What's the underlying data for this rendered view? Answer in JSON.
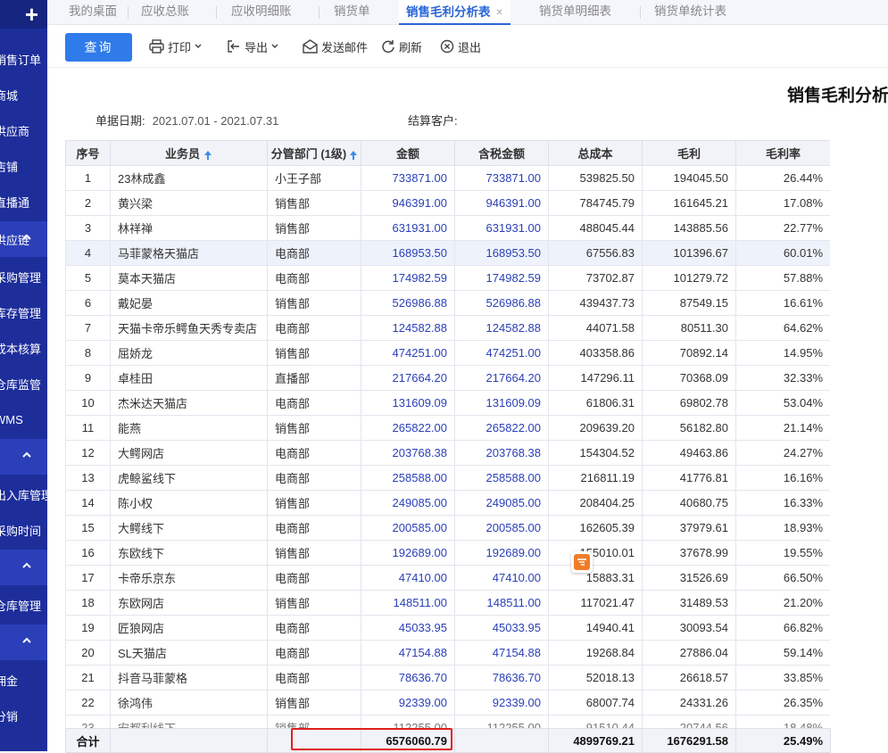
{
  "sidebar": {
    "plus_label": "+",
    "items": [
      {
        "label": "销售订单"
      },
      {
        "label": "商城"
      },
      {
        "label": "供应商"
      },
      {
        "label": "店铺"
      },
      {
        "label": "直播通"
      }
    ],
    "groups": [
      "供应链",
      "",
      "",
      ""
    ],
    "sub_items": [
      "采购管理",
      "库存管理",
      "成本核算",
      "仓库监管",
      "WMS",
      "出入库管理",
      "采购时间",
      "仓库管理",
      "佣金",
      "分销"
    ]
  },
  "tabs": [
    {
      "label": "我的桌面",
      "active": false
    },
    {
      "label": "应收总账",
      "active": false
    },
    {
      "label": "应收明细账",
      "active": false
    },
    {
      "label": "销货单",
      "active": false
    },
    {
      "label": "销售毛利分析表",
      "active": true,
      "close": "×"
    },
    {
      "label": "销货单明细表",
      "active": false
    },
    {
      "label": "销货单统计表",
      "active": false
    }
  ],
  "toolbar": {
    "query": "查询",
    "print": "打印",
    "export": "导出",
    "email": "发送邮件",
    "refresh": "刷新",
    "exit": "退出"
  },
  "report": {
    "title": "销售毛利分析表",
    "date_label": "单据日期:",
    "date_value": "2021.07.01 - 2021.07.31",
    "customer_label": "结算客户:",
    "customer_value": ""
  },
  "table": {
    "columns": [
      "序号",
      "业务员",
      "分管部门 (1级)",
      "金额",
      "含税金额",
      "总成本",
      "毛利",
      "毛利率"
    ],
    "rows": [
      [
        "1",
        "23林成鑫",
        "小王子部",
        "733871.00",
        "733871.00",
        "539825.50",
        "194045.50",
        "26.44%"
      ],
      [
        "2",
        "黄兴梁",
        "销售部",
        "946391.00",
        "946391.00",
        "784745.79",
        "161645.21",
        "17.08%"
      ],
      [
        "3",
        "林祥禅",
        "销售部",
        "631931.00",
        "631931.00",
        "488045.44",
        "143885.56",
        "22.77%"
      ],
      [
        "4",
        "马菲蒙格天猫店",
        "电商部",
        "168953.50",
        "168953.50",
        "67556.83",
        "101396.67",
        "60.01%"
      ],
      [
        "5",
        "莫本天猫店",
        "电商部",
        "174982.59",
        "174982.59",
        "73702.87",
        "101279.72",
        "57.88%"
      ],
      [
        "6",
        "戴妃晏",
        "销售部",
        "526986.88",
        "526986.88",
        "439437.73",
        "87549.15",
        "16.61%"
      ],
      [
        "7",
        "天猫卡帝乐鳄鱼天秀专卖店",
        "电商部",
        "124582.88",
        "124582.88",
        "44071.58",
        "80511.30",
        "64.62%"
      ],
      [
        "8",
        "屈娇龙",
        "销售部",
        "474251.00",
        "474251.00",
        "403358.86",
        "70892.14",
        "14.95%"
      ],
      [
        "9",
        "卓桂田",
        "直播部",
        "217664.20",
        "217664.20",
        "147296.11",
        "70368.09",
        "32.33%"
      ],
      [
        "10",
        "杰米达天猫店",
        "电商部",
        "131609.09",
        "131609.09",
        "61806.31",
        "69802.78",
        "53.04%"
      ],
      [
        "11",
        "能燕",
        "销售部",
        "265822.00",
        "265822.00",
        "209639.20",
        "56182.80",
        "21.14%"
      ],
      [
        "12",
        "大鳄网店",
        "电商部",
        "203768.38",
        "203768.38",
        "154304.52",
        "49463.86",
        "24.27%"
      ],
      [
        "13",
        "虎鲸鲨线下",
        "电商部",
        "258588.00",
        "258588.00",
        "216811.19",
        "41776.81",
        "16.16%"
      ],
      [
        "14",
        "陈小权",
        "销售部",
        "249085.00",
        "249085.00",
        "208404.25",
        "40680.75",
        "16.33%"
      ],
      [
        "15",
        "大鳄线下",
        "电商部",
        "200585.00",
        "200585.00",
        "162605.39",
        "37979.61",
        "18.93%"
      ],
      [
        "16",
        "东欧线下",
        "销售部",
        "192689.00",
        "192689.00",
        "155010.01",
        "37678.99",
        "19.55%"
      ],
      [
        "17",
        "卡帝乐京东",
        "电商部",
        "47410.00",
        "47410.00",
        "15883.31",
        "31526.69",
        "66.50%"
      ],
      [
        "18",
        "东欧网店",
        "销售部",
        "148511.00",
        "148511.00",
        "117021.47",
        "31489.53",
        "21.20%"
      ],
      [
        "19",
        "匠狼网店",
        "电商部",
        "45033.95",
        "45033.95",
        "14940.41",
        "30093.54",
        "66.82%"
      ],
      [
        "20",
        "SL天猫店",
        "电商部",
        "47154.88",
        "47154.88",
        "19268.84",
        "27886.04",
        "59.14%"
      ],
      [
        "21",
        "抖音马菲蒙格",
        "电商部",
        "78636.70",
        "78636.70",
        "52018.13",
        "26618.57",
        "33.85%"
      ],
      [
        "22",
        "徐鸿伟",
        "销售部",
        "92339.00",
        "92339.00",
        "68007.74",
        "24331.26",
        "26.35%"
      ],
      [
        "23",
        "安都利线下",
        "销售部",
        "112255.00",
        "112255.00",
        "91510.44",
        "20744.56",
        "18.48%"
      ]
    ],
    "totals": {
      "label": "合计",
      "amount": "6576060.79",
      "cost": "4899769.21",
      "profit": "1676291.58",
      "rate": "25.49%"
    }
  },
  "colors": {
    "sidebar": "#1d2e9b",
    "accent": "#2f7bea",
    "highlight_box": "#e02020",
    "amount_text": "#2a3fb8"
  }
}
